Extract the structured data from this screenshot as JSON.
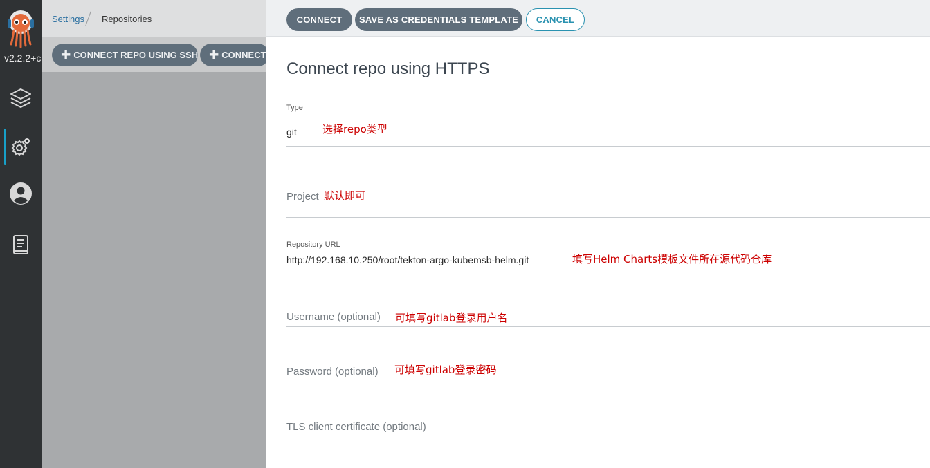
{
  "nav": {
    "version": "v2.2.2+c",
    "logo_icon": "argo-octopus-logo",
    "items": [
      {
        "icon": "layers-icon"
      },
      {
        "icon": "gear-icon"
      },
      {
        "icon": "user-icon"
      },
      {
        "icon": "docs-icon"
      }
    ]
  },
  "breadcrumb": {
    "parent": "Settings",
    "current": "Repositories"
  },
  "toolbar": {
    "connect_ssh": "CONNECT REPO USING SSH",
    "connect_https": "CONNECT REPO USING HTTPS"
  },
  "panel": {
    "buttons": {
      "connect": "CONNECT",
      "save_template": "SAVE AS CREDENTIALS TEMPLATE",
      "cancel": "CANCEL"
    },
    "title": "Connect repo using HTTPS",
    "type": {
      "label": "Type",
      "value": "git"
    },
    "project": {
      "label": "Project",
      "value": ""
    },
    "repo_url": {
      "label": "Repository URL",
      "value": "http://192.168.10.250/root/tekton-argo-kubemsb-helm.git"
    },
    "username": {
      "label": "Username (optional)",
      "value": ""
    },
    "password": {
      "label": "Password (optional)",
      "value": ""
    },
    "tls_cert": {
      "label": "TLS client certificate (optional)"
    }
  },
  "annotations": {
    "type_note": "选择repo类型",
    "project_note": "默认即可",
    "url_note": "填写Helm Charts模板文件所在源代码仓库",
    "username_note": "可填写gitlab登录用户名",
    "password_note": "可填写gitlab登录密码"
  },
  "colors": {
    "nav_bg": "#2f3234",
    "accent": "#18a0c8",
    "button": "#5f6e7b",
    "annotation": "#cc0000"
  }
}
